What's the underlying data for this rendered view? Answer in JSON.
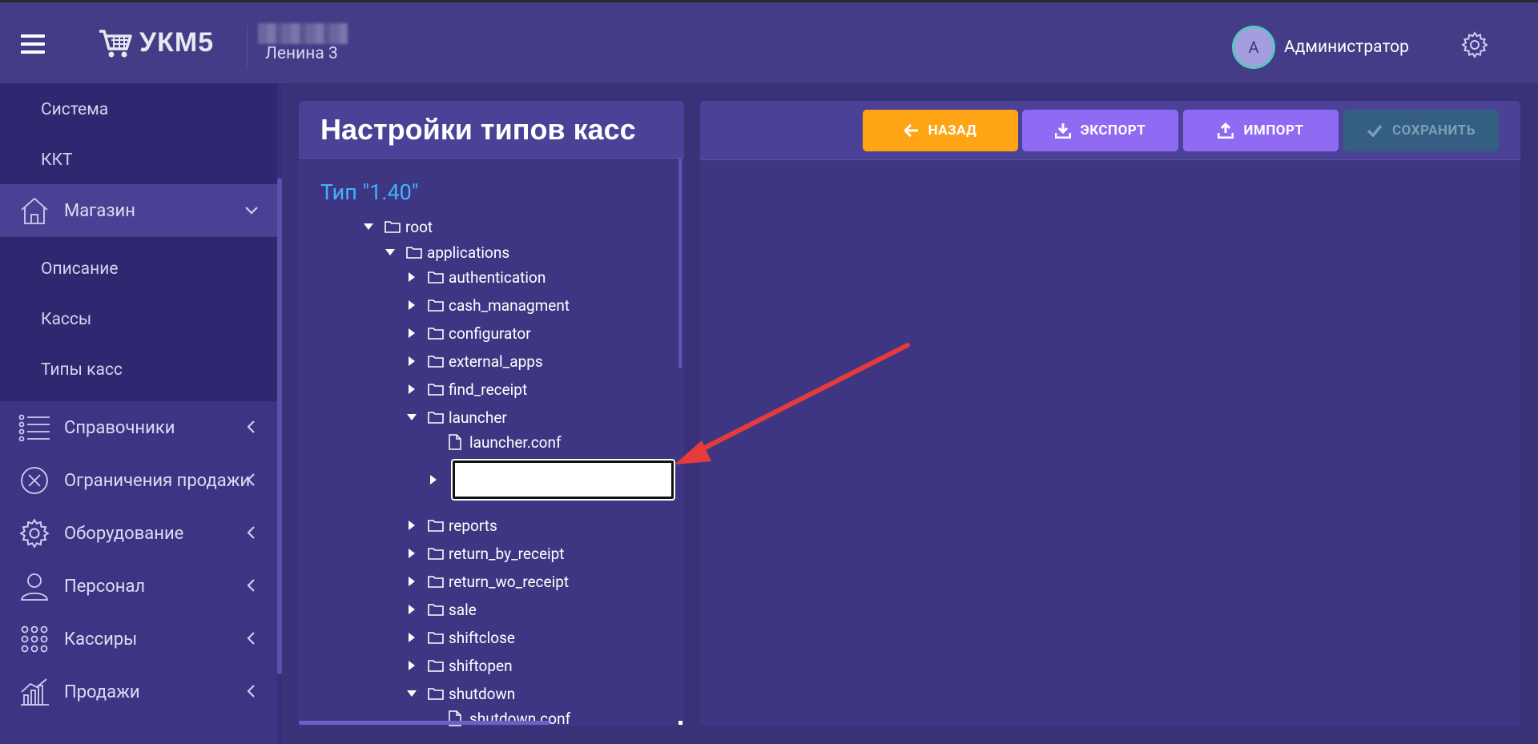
{
  "header": {
    "logo_text": "УКМ5",
    "store_name": "Ленина 3",
    "user_initial": "А",
    "user_name": "Администратор",
    "icons": [
      "menu-icon",
      "cart-icon",
      "gear-icon"
    ]
  },
  "sidebar": {
    "top_subitems": [
      "Система",
      "ККТ"
    ],
    "store": {
      "label": "Магазин",
      "icon": "home-icon"
    },
    "store_subitems": [
      "Описание",
      "Кассы",
      "Типы касс"
    ],
    "items": [
      {
        "label": "Справочники",
        "icon": "list-icon"
      },
      {
        "label": "Ограничения продажи",
        "icon": "cross-circle-icon"
      },
      {
        "label": "Оборудование",
        "icon": "gear-icon"
      },
      {
        "label": "Персонал",
        "icon": "person-icon"
      },
      {
        "label": "Кассиры",
        "icon": "dots-grid-icon"
      },
      {
        "label": "Продажи",
        "icon": "chart-icon"
      }
    ]
  },
  "tree": {
    "title": "Настройки типов касс",
    "type_label": "Тип \"1.40\"",
    "nodes": {
      "root": "root",
      "applications": "applications",
      "authentication": "authentication",
      "cash_managment": "cash_managment",
      "configurator": "configurator",
      "external_apps": "external_apps",
      "find_receipt": "find_receipt",
      "launcher": "launcher",
      "launcher_conf": "launcher.conf",
      "new_folder": "",
      "reports": "reports",
      "return_by_receipt": "return_by_receipt",
      "return_wo_receipt": "return_wo_receipt",
      "sale": "sale",
      "shiftclose": "shiftclose",
      "shiftopen": "shiftopen",
      "shutdown": "shutdown",
      "shutdown_conf": "shutdown.conf"
    }
  },
  "toolbar": {
    "back": "НАЗАД",
    "export": "ЭКСПОРТ",
    "import": "ИМПОРТ",
    "save": "СОХРАНИТЬ"
  },
  "colors": {
    "back_button": "#ffa515",
    "action_button": "#8f6bf3",
    "save_button_disabled": "#355f82",
    "type_label": "#3fb3ff",
    "annotation_arrow": "#e53b3b"
  }
}
